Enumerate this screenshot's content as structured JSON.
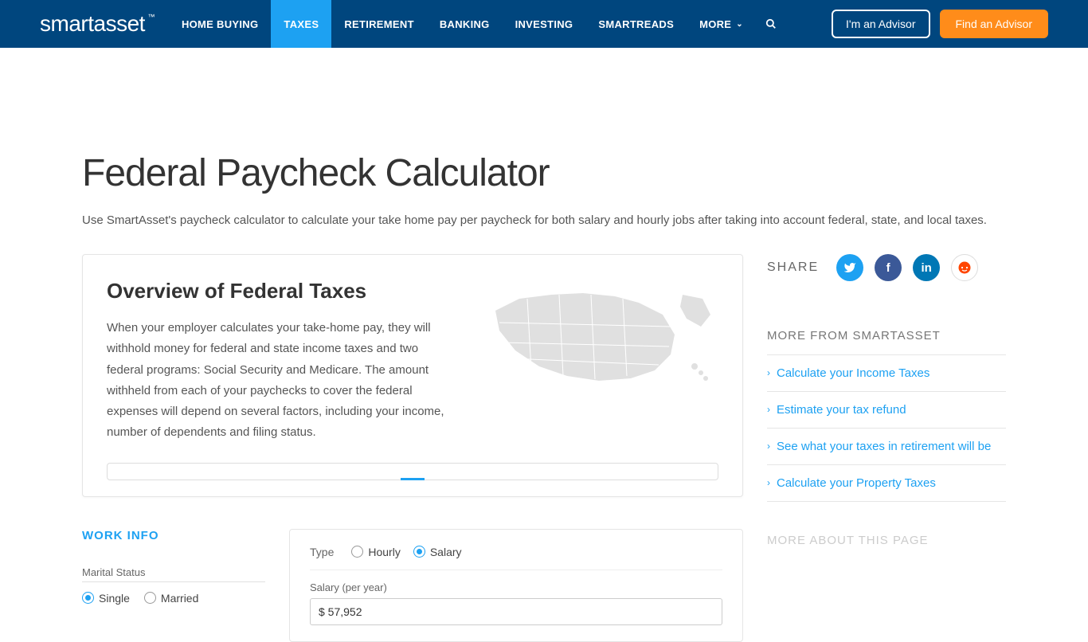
{
  "header": {
    "logo_text": "smartasset",
    "nav": [
      {
        "label": "HOME BUYING",
        "active": false
      },
      {
        "label": "TAXES",
        "active": true
      },
      {
        "label": "RETIREMENT",
        "active": false
      },
      {
        "label": "BANKING",
        "active": false
      },
      {
        "label": "INVESTING",
        "active": false
      },
      {
        "label": "SMARTREADS",
        "active": false
      },
      {
        "label": "MORE",
        "active": false,
        "dropdown": true
      }
    ],
    "advisor_button": "I'm an Advisor",
    "find_button": "Find an Advisor"
  },
  "page": {
    "title": "Federal Paycheck Calculator",
    "subtitle": "Use SmartAsset's paycheck calculator to calculate your take home pay per paycheck for both salary and hourly jobs after taking into account federal, state, and local taxes."
  },
  "overview": {
    "title": "Overview of Federal Taxes",
    "body": "When your employer calculates your take-home pay, they will withhold money for federal and state income taxes and two federal programs: Social Security and Medicare. The amount withheld from each of your paychecks to cover the federal expenses will depend on several factors, including your income, number of dependents and filing status."
  },
  "share": {
    "label": "SHARE"
  },
  "sidebar": {
    "more_heading": "MORE FROM SMARTASSET",
    "links": [
      "Calculate your Income Taxes",
      "Estimate your tax refund",
      "See what your taxes in retirement will be",
      "Calculate your Property Taxes"
    ],
    "about_heading": "MORE ABOUT THIS PAGE"
  },
  "work": {
    "section_label": "WORK INFO",
    "marital_label": "Marital Status",
    "marital_options": [
      "Single",
      "Married"
    ],
    "marital_selected": "Single",
    "type_label": "Type",
    "type_options": [
      "Hourly",
      "Salary"
    ],
    "type_selected": "Salary",
    "salary_label": "Salary (per year)",
    "salary_value": "$ 57,952"
  }
}
